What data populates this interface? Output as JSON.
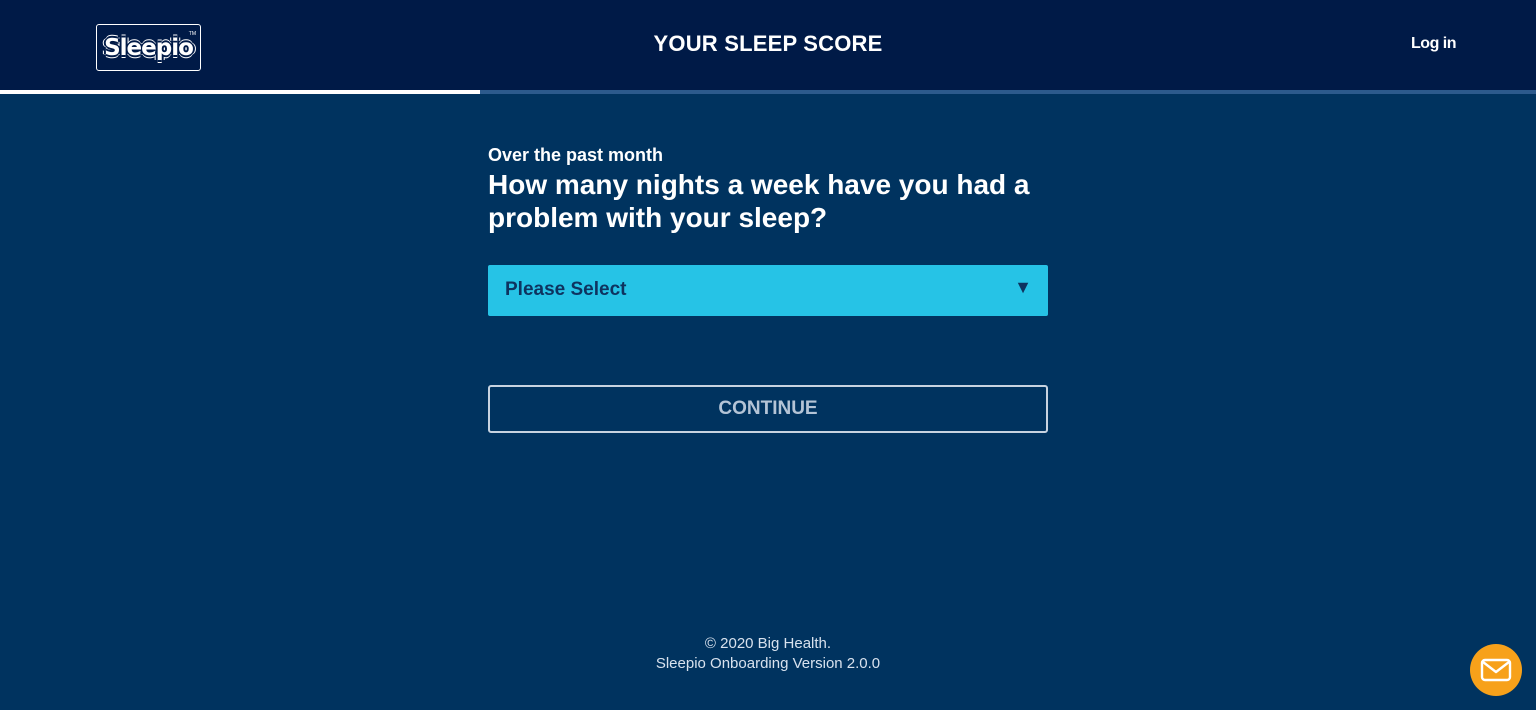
{
  "header": {
    "logo_text": "Sleepio",
    "title": "YOUR SLEEP SCORE",
    "login_label": "Log in"
  },
  "progress": {
    "fraction": 0.3125
  },
  "question": {
    "subheading": "Over the past month",
    "text": "How many nights a week have you had a problem with your sleep?"
  },
  "select": {
    "selected": "Please Select",
    "arrow": "▼"
  },
  "continue_label": "CONTINUE",
  "footer": {
    "copyright": "© 2020 Big Health.",
    "version": "Sleepio Onboarding Version 2.0.0"
  },
  "colors": {
    "page_background": "#00335f",
    "header_background": "#001a47",
    "select_background": "#26c3e6",
    "mail_button": "#f7a11a"
  },
  "icons": {
    "mail": "mail-icon",
    "dropdown": "chevron-down-icon"
  }
}
